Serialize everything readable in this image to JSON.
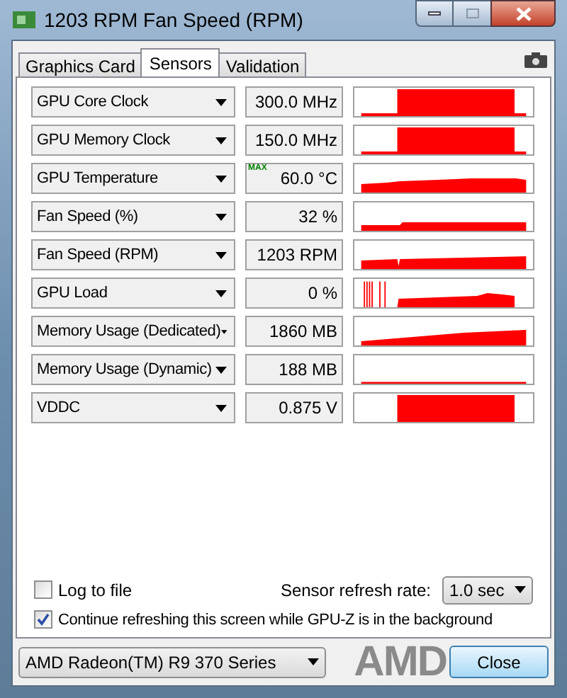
{
  "window": {
    "title": "1203 RPM Fan Speed (RPM)"
  },
  "tabs": [
    {
      "label": "Graphics Card",
      "selected": false
    },
    {
      "label": "Sensors",
      "selected": true
    },
    {
      "label": "Validation",
      "selected": false
    }
  ],
  "sensors": [
    {
      "name": "GPU Core Clock",
      "value": "300.0 MHz"
    },
    {
      "name": "GPU Memory Clock",
      "value": "150.0 MHz"
    },
    {
      "name": "GPU Temperature",
      "value": "60.0 °C",
      "badge": "MAX"
    },
    {
      "name": "Fan Speed (%)",
      "value": "32 %"
    },
    {
      "name": "Fan Speed (RPM)",
      "value": "1203 RPM"
    },
    {
      "name": "GPU Load",
      "value": "0 %"
    },
    {
      "name": "Memory Usage (Dedicated)",
      "value": "1860 MB"
    },
    {
      "name": "Memory Usage (Dynamic)",
      "value": "188 MB"
    },
    {
      "name": "VDDC",
      "value": "0.875 V"
    }
  ],
  "log_to_file": {
    "label": "Log to file",
    "checked": false
  },
  "refresh_rate": {
    "label": "Sensor refresh rate:",
    "value": "1.0 sec"
  },
  "background_refresh": {
    "label": "Continue refreshing this screen while GPU-Z is in the background",
    "checked": true
  },
  "gpu_select": {
    "value": "AMD Radeon(TM) R9 370 Series"
  },
  "logo": "AMD",
  "close_button": "Close"
}
